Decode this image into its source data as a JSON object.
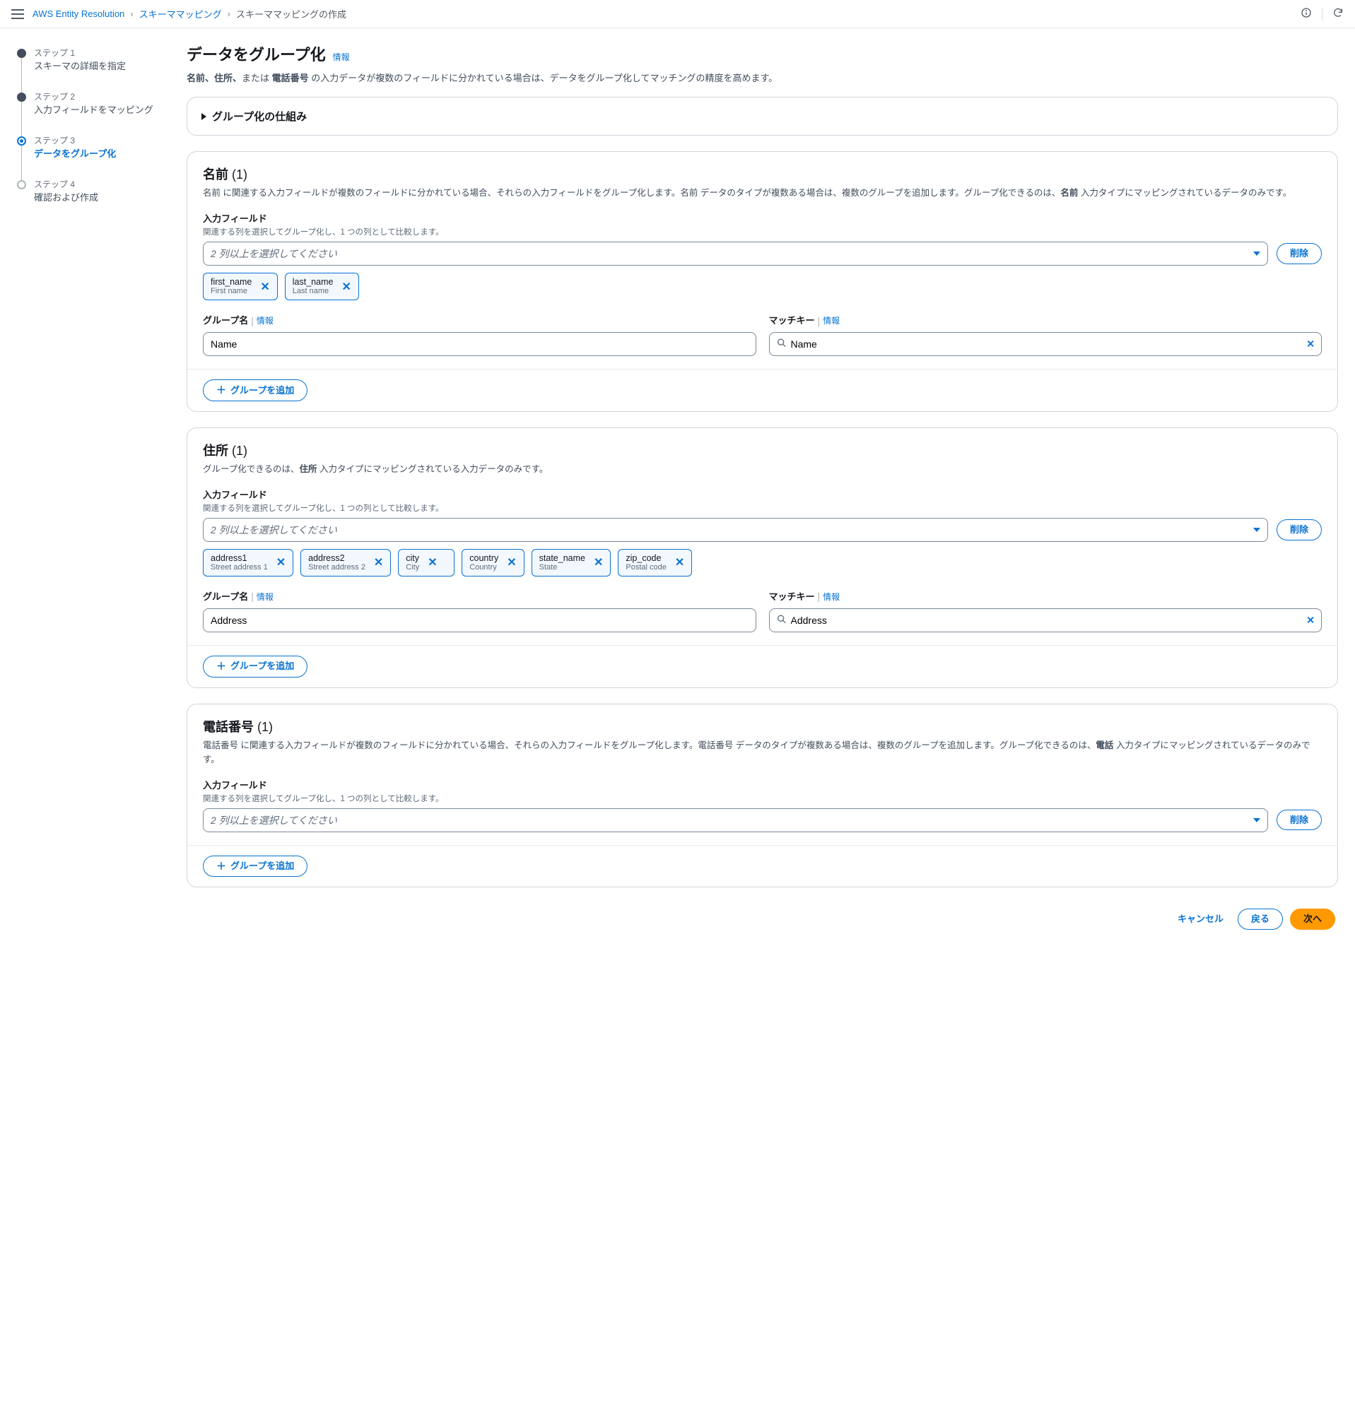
{
  "breadcrumb": {
    "root": "AWS Entity Resolution",
    "schema_mapping": "スキーママッピング",
    "current": "スキーママッピングの作成"
  },
  "stepper": {
    "step_prefix": "ステップ",
    "steps": [
      {
        "n": "1",
        "title": "スキーマの詳細を指定"
      },
      {
        "n": "2",
        "title": "入力フィールドをマッピング"
      },
      {
        "n": "3",
        "title": "データをグループ化"
      },
      {
        "n": "4",
        "title": "確認および作成"
      }
    ]
  },
  "page": {
    "title": "データをグループ化",
    "info": "情報",
    "sub_prefix": "名前、住所、",
    "sub_or": "または ",
    "sub_bold": "電話番号",
    "sub_rest": " の入力データが複数のフィールドに分かれている場合は、データをグループ化してマッチングの精度を高めます。"
  },
  "how_panel": {
    "title": "グループ化の仕組み"
  },
  "common": {
    "input_fields_label": "入力フィールド",
    "input_fields_help": "関連する列を選択してグループ化し、1 つの列として比較します。",
    "multiselect_placeholder": "2 列以上を選択してください",
    "delete_btn": "削除",
    "add_group_btn": "グループを追加",
    "group_name_label": "グループ名",
    "match_key_label": "マッチキー",
    "info": "情報"
  },
  "sections": {
    "name": {
      "title": "名前",
      "count": "(1)",
      "desc_parts": [
        "名前 に関連する入力フィールドが複数のフィールドに分かれている場合、それらの入力フィールドをグループ化します。名前 データのタイプが複数ある場合は、複数のグループを追加します。グループ化できるのは、",
        "名前",
        " 入力タイプにマッピングされているデータのみです。"
      ],
      "chips": [
        {
          "id": "first_name",
          "label": "First name"
        },
        {
          "id": "last_name",
          "label": "Last name"
        }
      ],
      "group_name_value": "Name",
      "match_key_value": "Name"
    },
    "address": {
      "title": "住所",
      "count": "(1)",
      "desc_parts": [
        "グループ化できるのは、",
        "住所",
        " 入力タイプにマッピングされている入力データのみです。"
      ],
      "chips": [
        {
          "id": "address1",
          "label": "Street address 1"
        },
        {
          "id": "address2",
          "label": "Street address 2"
        },
        {
          "id": "city",
          "label": "City"
        },
        {
          "id": "country",
          "label": "Country"
        },
        {
          "id": "state_name",
          "label": "State"
        },
        {
          "id": "zip_code",
          "label": "Postal code"
        }
      ],
      "group_name_value": "Address",
      "match_key_value": "Address"
    },
    "phone": {
      "title": "電話番号",
      "count": "(1)",
      "desc_parts": [
        "電話番号 に関連する入力フィールドが複数のフィールドに分かれている場合、それらの入力フィールドをグループ化します。電話番号 データのタイプが複数ある場合は、複数のグループを追加します。グループ化できるのは、",
        "電話",
        " 入力タイプにマッピングされているデータのみです。"
      ]
    }
  },
  "footer": {
    "cancel": "キャンセル",
    "back": "戻る",
    "next": "次へ"
  }
}
